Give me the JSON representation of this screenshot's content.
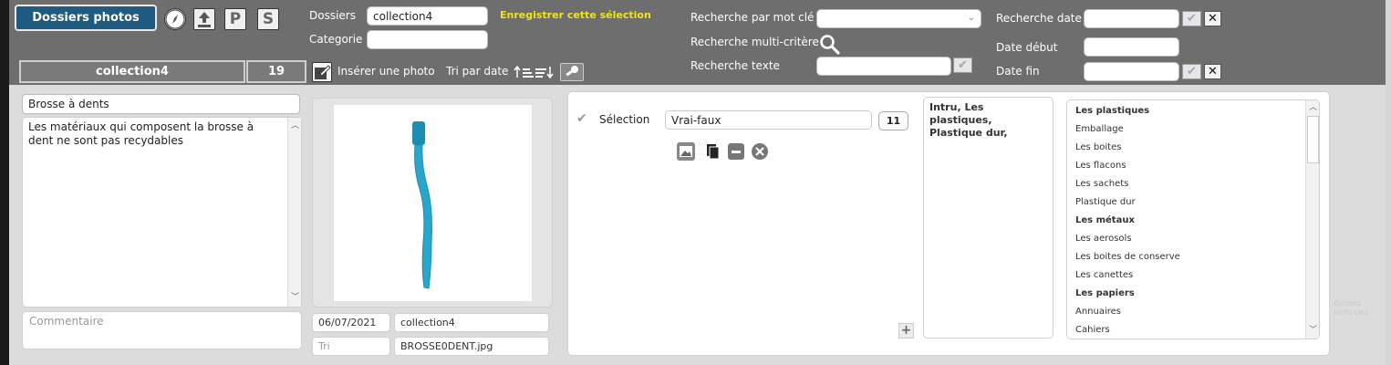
{
  "toolbar": {
    "dossiers_photos_button": "Dossiers photos",
    "compass_icon": "compass-icon",
    "upload_icon": "upload-icon",
    "p_button": "P",
    "s_button": "S",
    "collection_name": "collection4",
    "collection_count": "19",
    "insert_photo_label": "Insérer une photo",
    "sort_by_date_label": "Tri par date",
    "sort_icon": "sort-icon",
    "key_icon": "key-icon"
  },
  "filters": {
    "dossiers_label": "Dossiers",
    "dossiers_value": "collection4",
    "categorie_label": "Categorie",
    "categorie_value": "",
    "save_selection_link": "Enregistrer cette sélection",
    "keyword_search_label": "Recherche par mot clé",
    "keyword_search_value": "",
    "multi_criteria_label": "Recherche multi-critère",
    "text_search_label": "Recherche texte",
    "text_search_value": "",
    "date_search_label": "Recherche date",
    "date_search_value": "",
    "date_start_label": "Date début",
    "date_start_value": "",
    "date_end_label": "Date fin",
    "date_end_value": "",
    "check_glyph": "✔",
    "close_glyph": "✕"
  },
  "photo": {
    "title": "Brosse à dents",
    "description": "Les matériaux qui composent la brosse à dent ne sont pas recydables",
    "comment_placeholder": "Commentaire",
    "date": "06/07/2021",
    "collection": "collection4",
    "sort_field": "Tri",
    "filename": "BROSSE0DENT.jpg",
    "image_color": "#2aa6c8"
  },
  "selection": {
    "label": "Sélection",
    "value": "Vrai-faux",
    "count": "11",
    "plus_glyph": "+",
    "tags_text": "Intru, Les plastiques, Plastique dur,",
    "categories": [
      {
        "label": "Les plastiques",
        "bold": true
      },
      {
        "label": "Emballage",
        "bold": false
      },
      {
        "label": "Les boites",
        "bold": false
      },
      {
        "label": "Les flacons",
        "bold": false
      },
      {
        "label": "Les sachets",
        "bold": false
      },
      {
        "label": "Plastique dur",
        "bold": false
      },
      {
        "label": "Les métaux",
        "bold": true
      },
      {
        "label": "Les aerosols",
        "bold": false
      },
      {
        "label": "Les boites de conserve",
        "bold": false
      },
      {
        "label": "Les canettes",
        "bold": false
      },
      {
        "label": "Les papiers",
        "bold": true
      },
      {
        "label": "Annuaires",
        "bold": false
      },
      {
        "label": "Cahiers",
        "bold": false
      }
    ]
  },
  "faint_side_text": "Ajoutez mots clés"
}
